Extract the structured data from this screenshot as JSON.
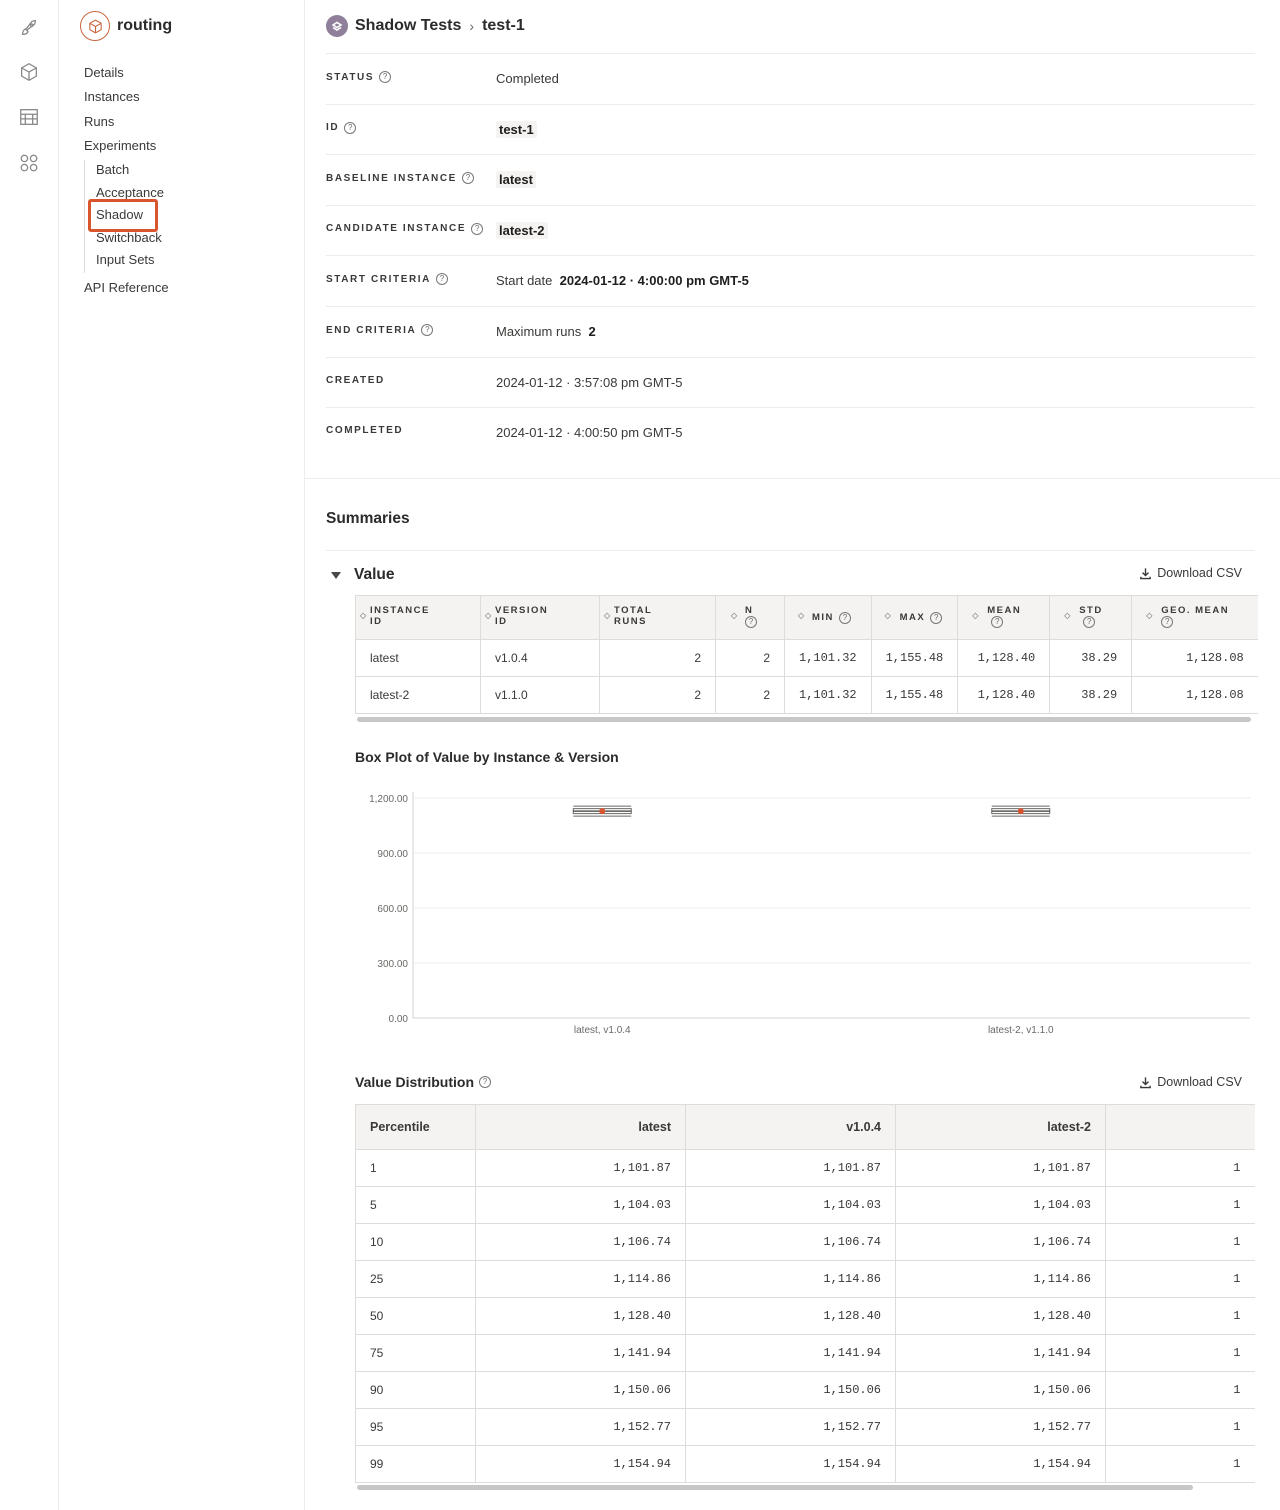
{
  "rail": {
    "icons": [
      "rocket-icon",
      "cube-icon",
      "marketplace-icon",
      "apps-grid-icon"
    ]
  },
  "sidebar": {
    "app_name": "routing",
    "nav": [
      "Details",
      "Instances",
      "Runs",
      "Experiments"
    ],
    "experiments": [
      "Batch",
      "Acceptance",
      "Shadow",
      "Switchback",
      "Input Sets"
    ],
    "api_reference": "API Reference"
  },
  "breadcrumb": {
    "parent": "Shadow Tests",
    "current": "test-1"
  },
  "details": {
    "status": {
      "label": "STATUS",
      "value": "Completed"
    },
    "id": {
      "label": "ID",
      "value": "test-1"
    },
    "baseline": {
      "label": "BASELINE INSTANCE",
      "value": "latest"
    },
    "candidate": {
      "label": "CANDIDATE INSTANCE",
      "value": "latest-2"
    },
    "start": {
      "label": "START CRITERIA",
      "prefix": "Start date",
      "value": "2024-01-12 · 4:00:00 pm GMT-5"
    },
    "end": {
      "label": "END CRITERIA",
      "prefix": "Maximum runs",
      "value": "2"
    },
    "created": {
      "label": "CREATED",
      "value": "2024-01-12 · 3:57:08 pm GMT-5"
    },
    "completed": {
      "label": "COMPLETED",
      "value": "2024-01-12 · 4:00:50 pm GMT-5"
    }
  },
  "summaries": {
    "title": "Summaries",
    "section": "Value",
    "download": "Download CSV",
    "columns": [
      {
        "l1": "INSTANCE",
        "l2": "ID"
      },
      {
        "l1": "VERSION",
        "l2": "ID"
      },
      {
        "l1": "TOTAL",
        "l2": "RUNS"
      },
      {
        "l1": "N",
        "l2": ""
      },
      {
        "l1": "MIN",
        "l2": ""
      },
      {
        "l1": "MAX",
        "l2": ""
      },
      {
        "l1": "MEAN",
        "l2": ""
      },
      {
        "l1": "STD",
        "l2": ""
      },
      {
        "l1": "GEO. MEAN",
        "l2": ""
      }
    ],
    "rows": [
      [
        "latest",
        "v1.0.4",
        "2",
        "2",
        "1,101.32",
        "1,155.48",
        "1,128.40",
        "38.29",
        "1,128.08"
      ],
      [
        "latest-2",
        "v1.1.0",
        "2",
        "2",
        "1,101.32",
        "1,155.48",
        "1,128.40",
        "38.29",
        "1,128.08"
      ]
    ]
  },
  "boxplot": {
    "title": "Box Plot of Value by Instance & Version"
  },
  "chart_data": {
    "type": "box",
    "title": "Box Plot of Value by Instance & Version",
    "categories": [
      "latest, v1.0.4",
      "latest-2, v1.1.0"
    ],
    "y_ticks": [
      "0.00",
      "300.00",
      "600.00",
      "900.00",
      "1,200.00"
    ],
    "ylim": [
      0,
      1200
    ],
    "boxes": [
      {
        "min": 1101.32,
        "q1": 1114.86,
        "median": 1128.4,
        "q3": 1141.94,
        "max": 1155.48,
        "mean": 1128.4
      },
      {
        "min": 1101.32,
        "q1": 1114.86,
        "median": 1128.4,
        "q3": 1141.94,
        "max": 1155.48,
        "mean": 1128.4
      }
    ],
    "grid": true,
    "colors": {
      "box": "#6b6966",
      "mean": "#d9552e"
    }
  },
  "distribution": {
    "title": "Value Distribution",
    "download": "Download CSV",
    "columns": [
      "Percentile",
      "latest",
      "v1.0.4",
      "latest-2",
      ""
    ],
    "rows": [
      [
        "1",
        "1,101.87",
        "1,101.87",
        "1,101.87",
        "1"
      ],
      [
        "5",
        "1,104.03",
        "1,104.03",
        "1,104.03",
        "1"
      ],
      [
        "10",
        "1,106.74",
        "1,106.74",
        "1,106.74",
        "1"
      ],
      [
        "25",
        "1,114.86",
        "1,114.86",
        "1,114.86",
        "1"
      ],
      [
        "50",
        "1,128.40",
        "1,128.40",
        "1,128.40",
        "1"
      ],
      [
        "75",
        "1,141.94",
        "1,141.94",
        "1,141.94",
        "1"
      ],
      [
        "90",
        "1,150.06",
        "1,150.06",
        "1,150.06",
        "1"
      ],
      [
        "95",
        "1,152.77",
        "1,152.77",
        "1,152.77",
        "1"
      ],
      [
        "99",
        "1,154.94",
        "1,154.94",
        "1,154.94",
        "1"
      ]
    ]
  }
}
